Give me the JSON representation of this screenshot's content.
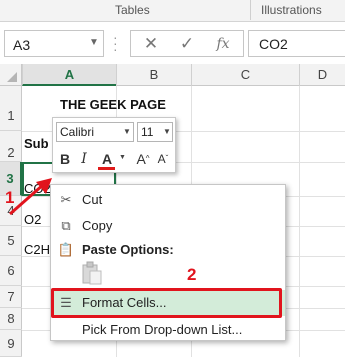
{
  "ribbon": {
    "groups": [
      "Tables",
      "Illustrations"
    ]
  },
  "namebox": {
    "value": "A3"
  },
  "formula_bar": {
    "cancel_icon": "✕",
    "enter_icon": "✓",
    "fx_label": "fx",
    "value": "CO2"
  },
  "columns": [
    "A",
    "B",
    "C",
    "D"
  ],
  "rows": [
    "1",
    "2",
    "3",
    "4",
    "5",
    "6",
    "7",
    "8",
    "9"
  ],
  "cells": {
    "title": "THE GEEK PAGE",
    "a2": "Sub",
    "a3": "CO2",
    "a4": "O2",
    "a5": "C2H"
  },
  "mini_toolbar": {
    "font": "Calibri",
    "size": "11",
    "bold": "B",
    "italic": "I",
    "font_color": "A",
    "grow": "A",
    "shrink": "A",
    "font_color_hex": "#e01b1b"
  },
  "context_menu": {
    "items": [
      "Cut",
      "Copy",
      "Paste Options:",
      "Format Cells...",
      "Pick From Drop-down List..."
    ],
    "highlight_hex": "#d3ecd9"
  },
  "annotations": {
    "step1": "1",
    "step2": "2",
    "color": "#e1141d"
  }
}
